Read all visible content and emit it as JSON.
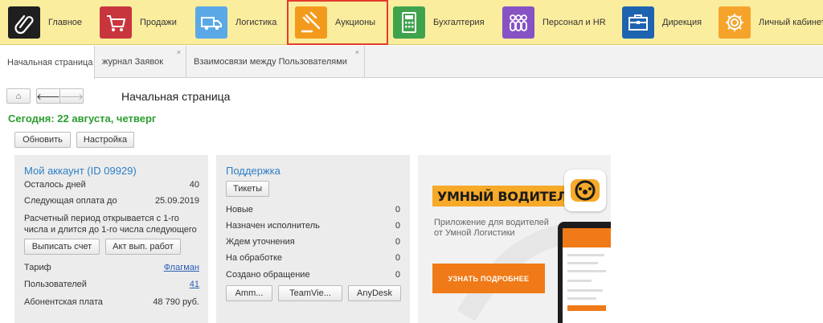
{
  "sections": [
    {
      "label": "Главное",
      "icon": "paperclip-icon",
      "color": "#1f1f1f"
    },
    {
      "label": "Продажи",
      "icon": "shopping-cart-icon",
      "color": "#c8353d"
    },
    {
      "label": "Логистика",
      "icon": "truck-icon",
      "color": "#5aa9e6"
    },
    {
      "label": "Аукционы",
      "icon": "gavel-icon",
      "color": "#f39a1d"
    },
    {
      "label": "Бухгалтерия",
      "icon": "calculator-icon",
      "color": "#3fa34d"
    },
    {
      "label": "Персонал и HR",
      "icon": "people-icon",
      "color": "#8652c4"
    },
    {
      "label": "Дирекция",
      "icon": "briefcase-icon",
      "color": "#1e63b0"
    },
    {
      "label": "Личный кабинет",
      "icon": "gear-icon",
      "color": "#f5a32a"
    }
  ],
  "tabs": [
    {
      "label": "Начальная страница"
    },
    {
      "label": "журнал Заявок",
      "close": "×"
    },
    {
      "label": "Взаимосвязи между Пользователями",
      "close": "×"
    }
  ],
  "nav": {
    "home": "⌂",
    "back": "🡐",
    "forward": "🡒"
  },
  "page": {
    "title": "Начальная страница",
    "today": "Сегодня: 22 августа, четверг",
    "refresh": "Обновить",
    "settings": "Настройка"
  },
  "account": {
    "title": "Мой аккаунт (ID 09929)",
    "days_left_label": "Осталось дней",
    "days_left": "40",
    "next_payment_label": "Следующая оплата до",
    "next_payment": "25.09.2019",
    "period_note": "Расчетный период открывается с 1-го числа и длится до 1-го числа следующего месяца.",
    "invoice_button": "Выписать счет",
    "act_button": "Акт вып. работ",
    "tariff_label": "Тариф",
    "tariff": "Флагман",
    "users_label": "Пользователей",
    "users": "41",
    "fee_label": "Абонентская плата",
    "fee": "48 790 руб."
  },
  "support": {
    "title": "Поддержка",
    "tickets_button": "Тикеты",
    "rows": [
      {
        "label": "Новые",
        "value": "0"
      },
      {
        "label": "Назначен исполнитель",
        "value": "0"
      },
      {
        "label": "Ждем уточнения",
        "value": "0"
      },
      {
        "label": "На обработке",
        "value": "0"
      },
      {
        "label": "Создано обращение",
        "value": "0"
      }
    ],
    "ammy_button": "Amm...",
    "teamviewer_button": "TeamVie...",
    "anydesk_button": "AnyDesk"
  },
  "ad": {
    "title": "УМНЫЙ ВОДИТЕЛЬ",
    "description": "Приложение для водителей от Умной Логистики",
    "cta": "УЗНАТЬ ПОДРОБНЕЕ"
  }
}
